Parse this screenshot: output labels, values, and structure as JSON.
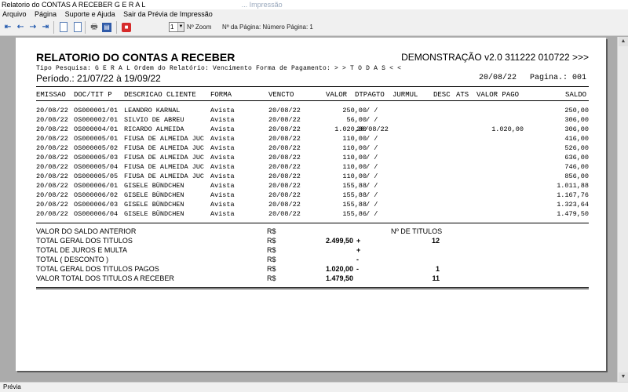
{
  "window": {
    "title": "Relatorio do CONTAS A RECEBER G E R A L",
    "ghost_title": "... Impressão"
  },
  "menu": {
    "items": [
      "Arquivo",
      "Página",
      "Suporte e Ajuda",
      "Sair da Prévia de Impressão"
    ]
  },
  "toolbar": {
    "zoom_value": "1",
    "zoom_label": "Nº Zoom",
    "page_label": "Nº da Página: Número Página: 1",
    "icons": [
      "first-page-icon",
      "prev-page-icon",
      "next-page-icon",
      "last-page-icon",
      "single-page-icon",
      "two-pages-icon",
      "print-icon",
      "book-icon",
      "stop-icon"
    ]
  },
  "report": {
    "title": "RELATORIO DO CONTAS A RECEBER",
    "demo": "DEMONSTRAÇÃO v2.0 311222 010722 >>>",
    "subtitle": "Tipo Pesquisa: G E R A L    Ordem do Relatório: Vencimento   Forma de Pagamento: > > T O D A S < <",
    "period": "Período.: 21/07/22 à 19/09/22",
    "date": "20/08/22",
    "page": "Pagina.: 001",
    "columns": {
      "emissao": "EMISSAO",
      "doc": "DOC/TIT P",
      "descricao": "DESCRICAO CLIENTE",
      "forma": "FORMA",
      "vencto": "VENCTO",
      "valor": "VALOR",
      "dtpagto": "DTPAGTO",
      "jurmul": "JURMUL",
      "desc": "DESC",
      "ats": "ATS",
      "valor_pago": "VALOR PAGO",
      "saldo": "SALDO"
    },
    "rows": [
      {
        "emissao": "20/08/22",
        "doc": "OS000001/01",
        "cliente": "LEANDRO KARNAL",
        "forma": "Avista",
        "vencto": "20/08/22",
        "valor": "250,00",
        "dtpagto": "/  /",
        "valor_pago": "",
        "saldo": "250,00"
      },
      {
        "emissao": "20/08/22",
        "doc": "OS000002/01",
        "cliente": "SILVIO DE ABREU",
        "forma": "Avista",
        "vencto": "20/08/22",
        "valor": "56,00",
        "dtpagto": "/  /",
        "valor_pago": "",
        "saldo": "306,00"
      },
      {
        "emissao": "20/08/22",
        "doc": "OS000004/01",
        "cliente": "RICARDO ALMEIDA",
        "forma": "Avista",
        "vencto": "20/08/22",
        "valor": "1.020,00",
        "dtpagto": "20/08/22",
        "valor_pago": "1.020,00",
        "saldo": "306,00"
      },
      {
        "emissao": "20/08/22",
        "doc": "OS000005/01",
        "cliente": "FIUSA DE ALMEIDA JUC",
        "forma": "Avista",
        "vencto": "20/08/22",
        "valor": "110,00",
        "dtpagto": "/  /",
        "valor_pago": "",
        "saldo": "416,00"
      },
      {
        "emissao": "20/08/22",
        "doc": "OS000005/02",
        "cliente": "FIUSA DE ALMEIDA JUC",
        "forma": "Avista",
        "vencto": "20/08/22",
        "valor": "110,00",
        "dtpagto": "/  /",
        "valor_pago": "",
        "saldo": "526,00"
      },
      {
        "emissao": "20/08/22",
        "doc": "OS000005/03",
        "cliente": "FIUSA DE ALMEIDA JUC",
        "forma": "Avista",
        "vencto": "20/08/22",
        "valor": "110,00",
        "dtpagto": "/  /",
        "valor_pago": "",
        "saldo": "636,00"
      },
      {
        "emissao": "20/08/22",
        "doc": "OS000005/04",
        "cliente": "FIUSA DE ALMEIDA JUC",
        "forma": "Avista",
        "vencto": "20/08/22",
        "valor": "110,00",
        "dtpagto": "/  /",
        "valor_pago": "",
        "saldo": "746,00"
      },
      {
        "emissao": "20/08/22",
        "doc": "OS000005/05",
        "cliente": "FIUSA DE ALMEIDA JUC",
        "forma": "Avista",
        "vencto": "20/08/22",
        "valor": "110,00",
        "dtpagto": "/  /",
        "valor_pago": "",
        "saldo": "856,00"
      },
      {
        "emissao": "20/08/22",
        "doc": "OS000006/01",
        "cliente": "GISELE BÜNDCHEN",
        "forma": "Avista",
        "vencto": "20/08/22",
        "valor": "155,88",
        "dtpagto": "/  /",
        "valor_pago": "",
        "saldo": "1.011,88"
      },
      {
        "emissao": "20/08/22",
        "doc": "OS000006/02",
        "cliente": "GISELE BÜNDCHEN",
        "forma": "Avista",
        "vencto": "20/08/22",
        "valor": "155,88",
        "dtpagto": "/  /",
        "valor_pago": "",
        "saldo": "1.167,76"
      },
      {
        "emissao": "20/08/22",
        "doc": "OS000006/03",
        "cliente": "GISELE BÜNDCHEN",
        "forma": "Avista",
        "vencto": "20/08/22",
        "valor": "155,88",
        "dtpagto": "/  /",
        "valor_pago": "",
        "saldo": "1.323,64"
      },
      {
        "emissao": "20/08/22",
        "doc": "OS000006/04",
        "cliente": "GISELE BÜNDCHEN",
        "forma": "Avista",
        "vencto": "20/08/22",
        "valor": "155,86",
        "dtpagto": "/  /",
        "valor_pago": "",
        "saldo": "1.479,50"
      }
    ],
    "summary": [
      {
        "label": "VALOR DO SALDO ANTERIOR",
        "currency": "R$",
        "value": "",
        "sign": "",
        "count": "Nº DE TITULOS"
      },
      {
        "label": "TOTAL GERAL DOS TITULOS",
        "currency": "R$",
        "value": "2.499,50",
        "sign": "+",
        "count": "12"
      },
      {
        "label": "TOTAL DE JUROS E MULTA",
        "currency": "R$",
        "value": "",
        "sign": "+",
        "count": ""
      },
      {
        "label": "TOTAL ( DESCONTO )",
        "currency": "R$",
        "value": "",
        "sign": "-",
        "count": ""
      },
      {
        "label": "TOTAL GERAL DOS TITULOS PAGOS",
        "currency": "R$",
        "value": "1.020,00",
        "sign": "-",
        "count": "1"
      },
      {
        "label": "VALOR TOTAL DOS TITULOS A RECEBER",
        "currency": "R$",
        "value": "1.479,50",
        "sign": "",
        "count": "11"
      }
    ]
  },
  "statusbar": {
    "text": "Prévia"
  }
}
